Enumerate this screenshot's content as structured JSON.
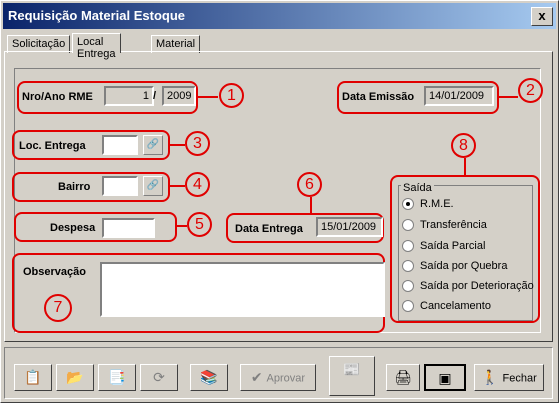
{
  "window": {
    "title": "Requisição Material Estoque",
    "close_symbol": "x",
    "title_gradient": [
      "#0a246a",
      "#a6caf0"
    ]
  },
  "tabs": [
    {
      "label": "Solicitação"
    },
    {
      "label": "Local Entrega",
      "active": true
    },
    {
      "label": "Material"
    }
  ],
  "form": {
    "nro_ano_label": "Nro/Ano RME",
    "nro_value": "1",
    "separator": "/",
    "ano_value": "2009",
    "data_emissao_label": "Data Emissão",
    "data_emissao_value": "14/01/2009",
    "loc_entrega_label": "Loc. Entrega",
    "loc_entrega_value": "",
    "bairro_label": "Bairro",
    "bairro_value": "",
    "despesa_label": "Despesa",
    "despesa_value": "",
    "data_entrega_label": "Data Entrega",
    "data_entrega_value": "15/01/2009",
    "observacao_label": "Observação",
    "observacao_value": ""
  },
  "saida": {
    "title": "Saída",
    "options": [
      {
        "label": "R.M.E.",
        "selected": true
      },
      {
        "label": "Transferência"
      },
      {
        "label": "Saída Parcial"
      },
      {
        "label": "Saída por Quebra"
      },
      {
        "label": "Saída por Deterioração"
      },
      {
        "label": "Cancelamento"
      }
    ]
  },
  "callouts": {
    "c1": "1",
    "c2": "2",
    "c3": "3",
    "c4": "4",
    "c5": "5",
    "c6": "6",
    "c7": "7",
    "c8": "8",
    "color": "#e00000"
  },
  "toolbar": {
    "aprovar_label": "Aprovar",
    "fechar_label": "Fechar",
    "icons": {
      "b1": "📋",
      "b2": "📂",
      "b3": "📑",
      "b4": "⟳",
      "b5": "📚",
      "b7": "📰",
      "b8": "🖨",
      "b9": "▣",
      "check": "✔",
      "exit": "🚶"
    }
  },
  "lookup_icon": "🔗"
}
